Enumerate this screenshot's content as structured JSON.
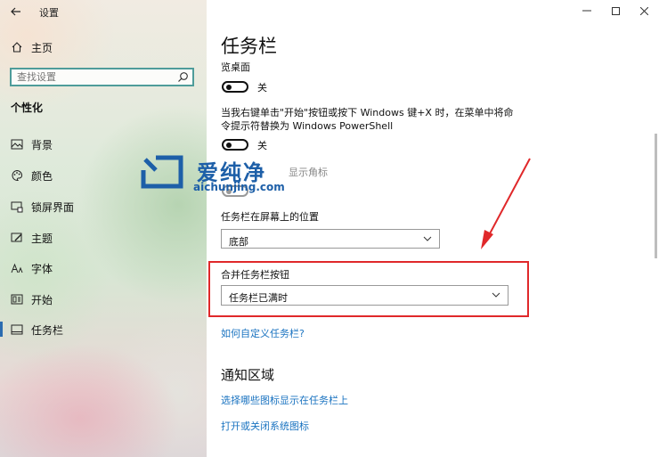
{
  "window": {
    "title": "设置"
  },
  "sidebar": {
    "home_label": "主页",
    "search_placeholder": "查找设置",
    "section_title": "个性化",
    "items": [
      {
        "label": "背景",
        "icon": "picture-icon"
      },
      {
        "label": "颜色",
        "icon": "palette-icon"
      },
      {
        "label": "锁屏界面",
        "icon": "lock-screen-icon"
      },
      {
        "label": "主题",
        "icon": "theme-icon"
      },
      {
        "label": "字体",
        "icon": "font-icon"
      },
      {
        "label": "开始",
        "icon": "start-icon"
      },
      {
        "label": "任务栏",
        "icon": "taskbar-icon",
        "active": true
      }
    ]
  },
  "main": {
    "title": "任务栏",
    "setting1": {
      "label": "览桌面",
      "state": "关"
    },
    "setting2": {
      "label_line1": "当我右键单击\"开始\"按钮或按下 Windows 键+X 时，在菜单中将命",
      "label_line2": "令提示符替换为 Windows PowerShell",
      "state": "关"
    },
    "setting3": {
      "label": "显示角标"
    },
    "position": {
      "label": "任务栏在屏幕上的位置",
      "value": "底部"
    },
    "combine": {
      "label": "合并任务栏按钮",
      "value": "任务栏已满时"
    },
    "help_link": "如何自定义任务栏?",
    "notification": {
      "heading": "通知区域",
      "link1": "选择哪些图标显示在任务栏上",
      "link2": "打开或关闭系统图标"
    }
  },
  "watermark": {
    "cn": "爱纯净",
    "en": "aichunjing.com"
  },
  "colors": {
    "accent": "#1a73c0",
    "highlight": "#e0282a",
    "search_border": "#4e9c9a"
  }
}
